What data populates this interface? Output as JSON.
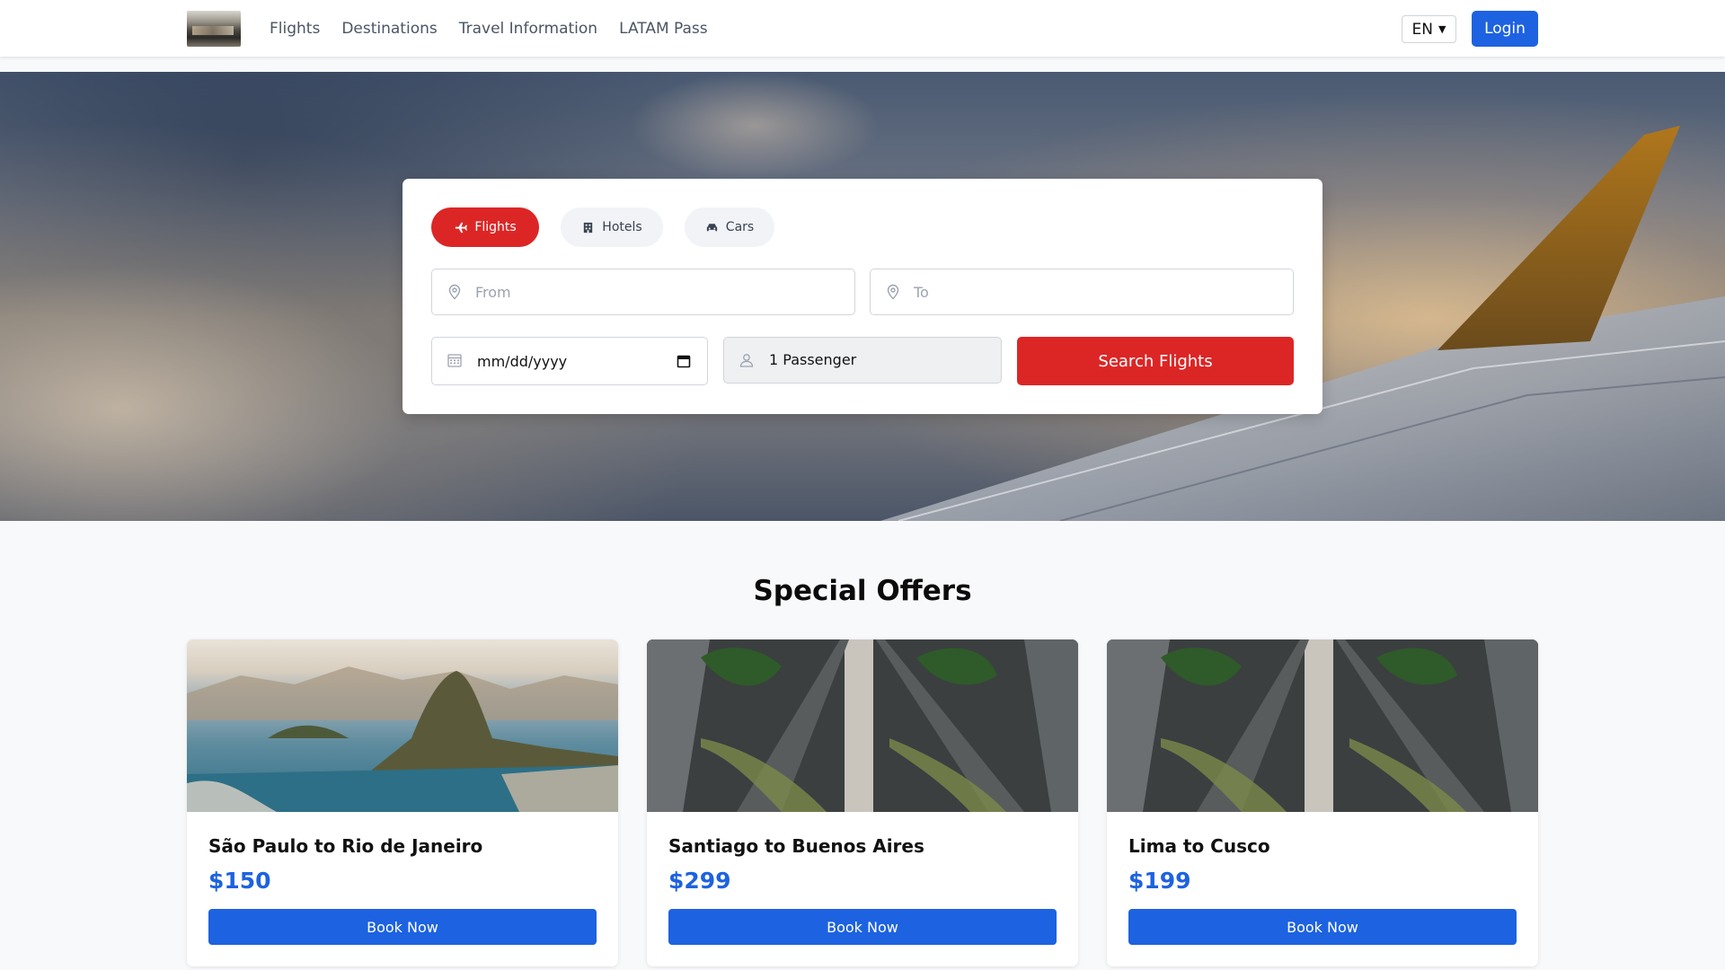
{
  "nav": {
    "links": [
      "Flights",
      "Destinations",
      "Travel Information",
      "LATAM Pass"
    ],
    "language": "EN",
    "login": "Login"
  },
  "search": {
    "tabs": [
      {
        "label": "Flights",
        "icon": "plane-icon",
        "active": true
      },
      {
        "label": "Hotels",
        "icon": "building-icon",
        "active": false
      },
      {
        "label": "Cars",
        "icon": "car-icon",
        "active": false
      }
    ],
    "from_placeholder": "From",
    "to_placeholder": "To",
    "date_placeholder": "mm/dd/yyyy",
    "passengers": "1 Passenger",
    "button": "Search Flights"
  },
  "offers": {
    "title": "Special Offers",
    "items": [
      {
        "route": "São Paulo to Rio de Janeiro",
        "price": "$150",
        "button": "Book Now"
      },
      {
        "route": "Santiago to Buenos Aires",
        "price": "$299",
        "button": "Book Now"
      },
      {
        "route": "Lima to Cusco",
        "price": "$199",
        "button": "Book Now"
      }
    ]
  },
  "colors": {
    "accent_red": "#dc2626",
    "accent_blue": "#1d62e0"
  }
}
